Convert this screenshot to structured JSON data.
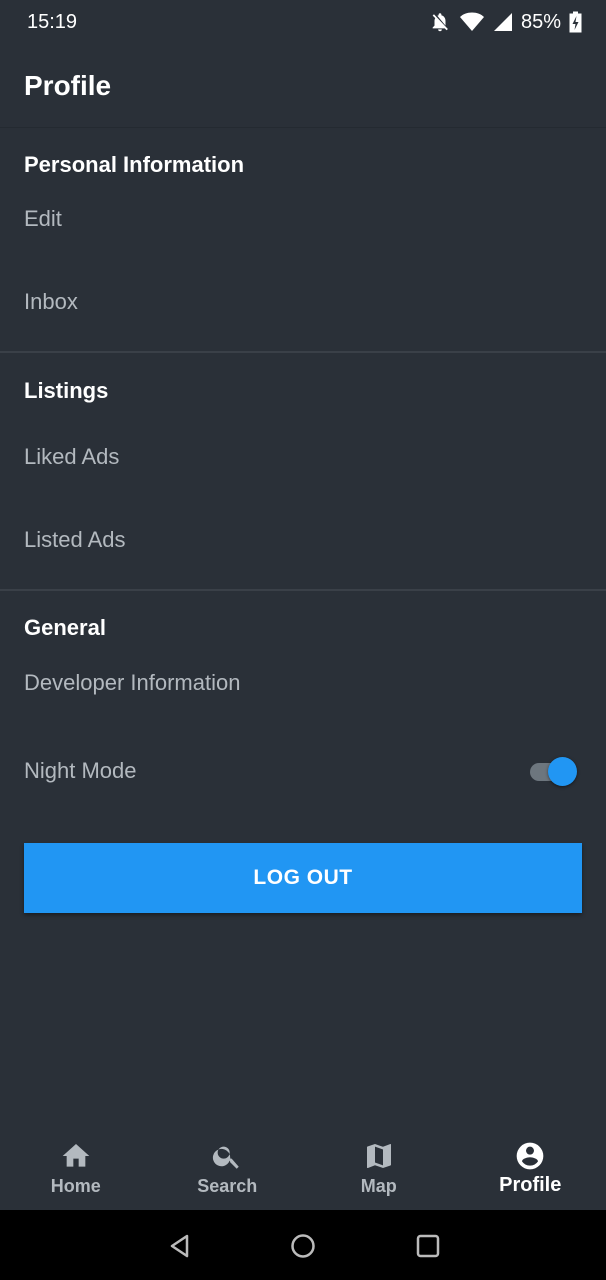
{
  "status_bar": {
    "time": "15:19",
    "battery": "85%",
    "icons": [
      "bell-off-icon",
      "wifi-icon",
      "signal-icon",
      "battery-charging-icon"
    ]
  },
  "header": {
    "title": "Profile"
  },
  "sections": [
    {
      "title": "Personal Information",
      "items": [
        "Edit",
        "Inbox"
      ]
    },
    {
      "title": "Listings",
      "items": [
        "Liked Ads",
        "Listed Ads"
      ]
    },
    {
      "title": "General",
      "items": [
        "Developer Information",
        "Night Mode"
      ]
    }
  ],
  "night_mode": {
    "enabled": true
  },
  "logout": {
    "label": "LOG OUT"
  },
  "bottom_nav": [
    {
      "label": "Home",
      "icon": "home-icon",
      "active": false
    },
    {
      "label": "Search",
      "icon": "search-icon",
      "active": false
    },
    {
      "label": "Map",
      "icon": "map-icon",
      "active": false
    },
    {
      "label": "Profile",
      "icon": "account-circle-icon",
      "active": true
    }
  ],
  "colors": {
    "background": "#2a3038",
    "accent": "#2196f3",
    "text_primary": "#ffffff",
    "text_secondary": "#b3b9bf",
    "divider": "#3a4048"
  }
}
